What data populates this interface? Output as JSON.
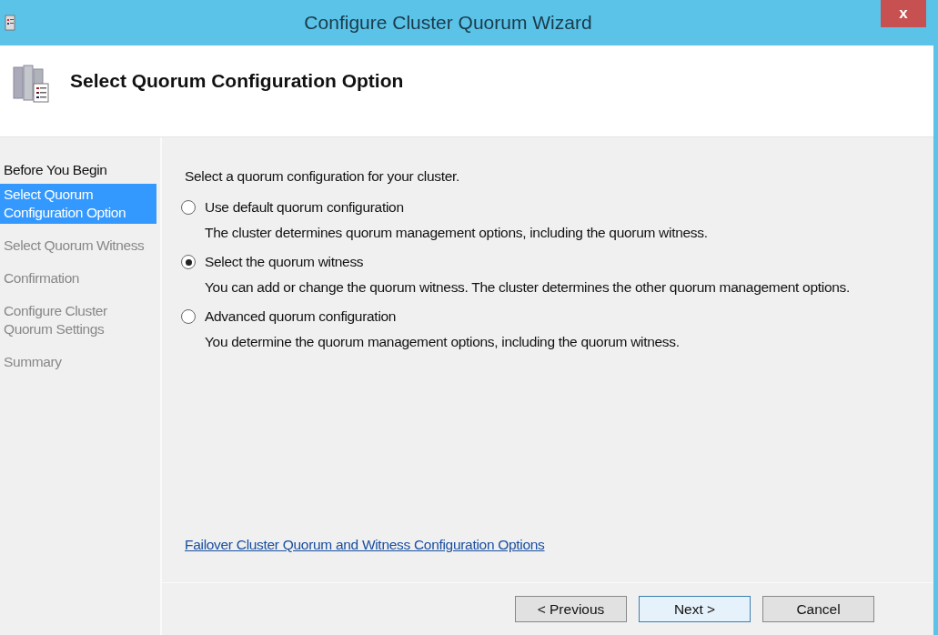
{
  "window": {
    "title": "Configure Cluster Quorum Wizard",
    "close": "x"
  },
  "header": {
    "title": "Select Quorum Configuration Option"
  },
  "steps": [
    {
      "label": "Before You Begin",
      "selected": false,
      "disabled": false
    },
    {
      "label": "Select Quorum Configuration Option",
      "selected": true,
      "disabled": false
    },
    {
      "label": "Select Quorum Witness",
      "selected": false,
      "disabled": true
    },
    {
      "label": "Confirmation",
      "selected": false,
      "disabled": true
    },
    {
      "label": "Configure Cluster Quorum Settings",
      "selected": false,
      "disabled": true
    },
    {
      "label": "Summary",
      "selected": false,
      "disabled": true
    }
  ],
  "prompt": "Select a quorum configuration for your cluster.",
  "options": [
    {
      "label": "Use default quorum configuration",
      "description": "The cluster determines quorum management options, including the quorum witness.",
      "selected": false
    },
    {
      "label": "Select the quorum witness",
      "description": "You can add or change the quorum witness. The cluster determines the other quorum management options.",
      "selected": true
    },
    {
      "label": "Advanced quorum configuration",
      "description": "You determine the quorum management options, including the quorum witness.",
      "selected": false
    }
  ],
  "help_link": "Failover Cluster Quorum and Witness Configuration Options",
  "buttons": [
    {
      "label": "< Previous",
      "kind": "back"
    },
    {
      "label": "Next >",
      "kind": "default"
    },
    {
      "label": "Cancel",
      "kind": "cancel"
    }
  ]
}
